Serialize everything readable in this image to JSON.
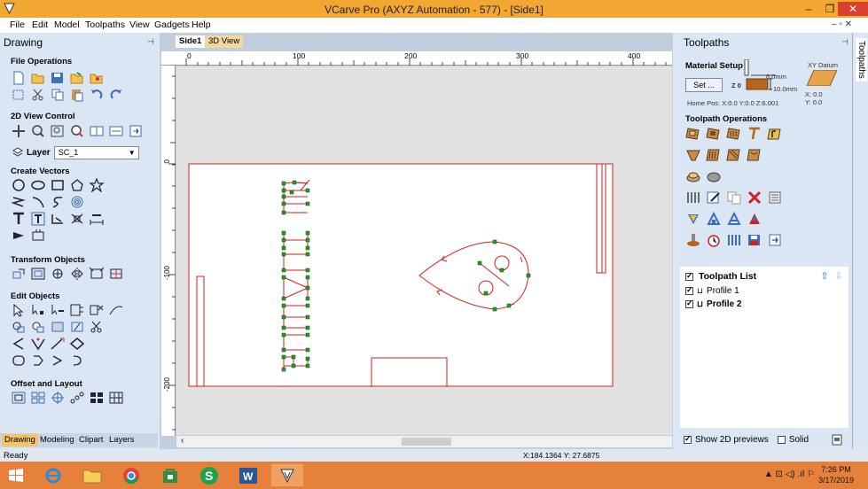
{
  "window": {
    "title": "VCarve Pro (AXYZ Automation - 577) - [Side1]",
    "minimize_icon": "minimize-icon",
    "restore_icon": "restore-icon",
    "close_icon": "close-icon",
    "min_glyph": "–",
    "restore_glyph": "❐",
    "close_glyph": "✕"
  },
  "menu": {
    "items": [
      "File",
      "Edit",
      "Model",
      "Toolpaths",
      "View",
      "Gadgets",
      "Help"
    ],
    "mdi_controls": "– ▫ ✕"
  },
  "left_panel": {
    "title": "Drawing",
    "pin": "⊣",
    "sections": {
      "file_ops": "File Operations",
      "view_control": "2D View Control",
      "create_vectors": "Create Vectors",
      "transform": "Transform Objects",
      "edit": "Edit Objects",
      "offset": "Offset and Layout"
    },
    "layer_label": "Layer",
    "layer_value": "SC_1",
    "tabs": [
      "Drawing",
      "Modeling",
      "Clipart",
      "Layers"
    ]
  },
  "document": {
    "tabs": [
      "Side1",
      "3D View"
    ],
    "ruler_h": [
      "0",
      "100",
      "200",
      "300",
      "400"
    ],
    "ruler_v": [
      "0",
      "-100",
      "-200"
    ]
  },
  "right_panel": {
    "title": "Toolpaths",
    "pin": "⊣",
    "side_tab": "Toolpaths",
    "material_setup": "Material Setup",
    "thickness": "6.0mm",
    "z_offset": "10.0mm",
    "set_button": "Set ...",
    "z_label": "Z 0",
    "home_pos": "Home Pos:  X:0.0 Y:0.0 Z:6.001",
    "xy_datum": "XY Datum",
    "datum_x": "X: 0.0",
    "datum_y": "Y: 0.0",
    "toolpath_operations": "Toolpath Operations",
    "toolpath_list": "Toolpath List",
    "toolpaths": [
      "Profile 1",
      "Profile 2"
    ],
    "show_2d": "Show 2D previews",
    "solid": "Solid"
  },
  "status": {
    "left": "Ready",
    "coords": "X:184.1364 Y: 27.6875"
  },
  "taskbar": {
    "time": "7:26 PM",
    "date": "3/17/2019",
    "tray": "▲ ⊡ ◁) .ıl ⚐"
  },
  "colors": {
    "title_bar": "#f2a733",
    "taskbar": "#e6813b",
    "panel_bg": "#dbe6f4",
    "vector_red": "#d02020",
    "node_green": "#2a9a2a"
  }
}
